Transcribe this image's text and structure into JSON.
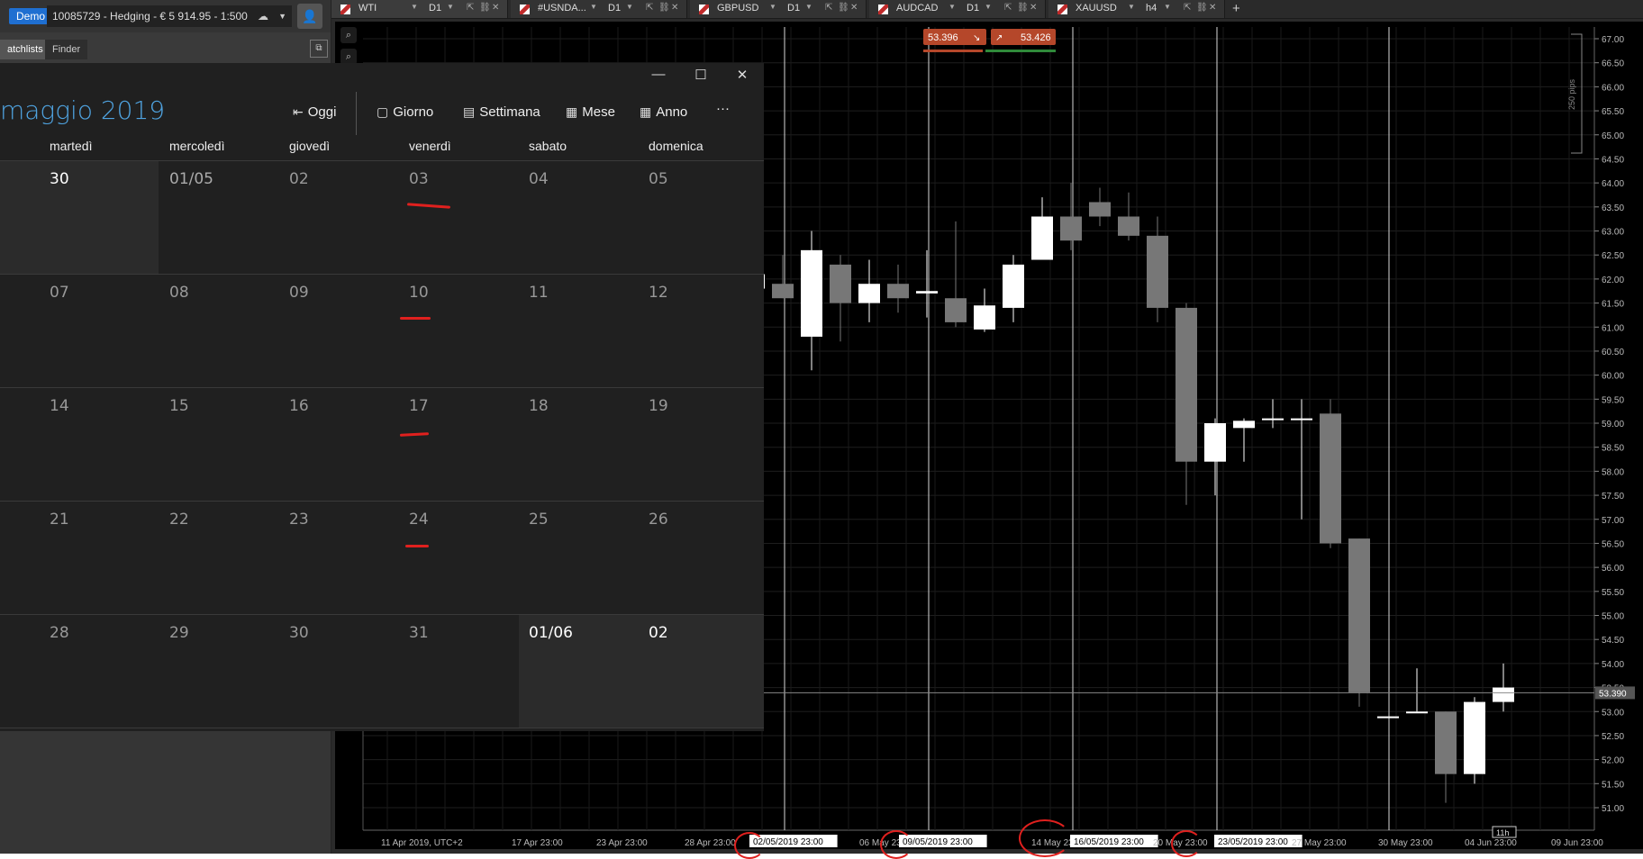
{
  "account": {
    "mode_badge": "Demo",
    "selector_label": "10085729 - Hedging - € 5 914.95 - 1:500"
  },
  "left_tabs": [
    "atchlists",
    "Finder"
  ],
  "chart_tabs": [
    {
      "symbol": "WTI",
      "timeframe": "D1"
    },
    {
      "symbol": "#USNDA...",
      "timeframe": "D1"
    },
    {
      "symbol": "GBPUSD",
      "timeframe": "D1"
    },
    {
      "symbol": "AUDCAD",
      "timeframe": "D1"
    },
    {
      "symbol": "XAUUSD",
      "timeframe": "h4"
    }
  ],
  "trade_buttons": {
    "sell": "53.39",
    "sell_suffix": "6",
    "buy": "53.42",
    "buy_suffix": "6"
  },
  "current_price_label": "53.390",
  "scale_note": "250 pips",
  "count_badge": "11h",
  "calendar": {
    "month_title": "maggio 2019",
    "buttons": {
      "today": "Oggi",
      "day": "Giorno",
      "week": "Settimana",
      "month": "Mese",
      "year": "Anno",
      "more": "···"
    },
    "weekdays": [
      "martedì",
      "mercoledì",
      "giovedì",
      "venerdì",
      "sabato",
      "domenica"
    ],
    "weeks": [
      [
        "30",
        "01/05",
        "02",
        "03",
        "04",
        "05"
      ],
      [
        "07",
        "08",
        "09",
        "10",
        "11",
        "12"
      ],
      [
        "14",
        "15",
        "16",
        "17",
        "18",
        "19"
      ],
      [
        "21",
        "22",
        "23",
        "24",
        "25",
        "26"
      ],
      [
        "28",
        "29",
        "30",
        "31",
        "01/06",
        "02"
      ]
    ]
  },
  "chart_data": {
    "type": "candlestick",
    "symbol": "WTI",
    "timeframe": "D1",
    "ylim": [
      50.6,
      67.3
    ],
    "y_ticks": [
      "67.00",
      "66.50",
      "66.00",
      "65.50",
      "65.00",
      "64.50",
      "64.00",
      "63.50",
      "63.00",
      "62.50",
      "62.00",
      "61.50",
      "61.00",
      "60.50",
      "60.00",
      "59.50",
      "59.00",
      "58.50",
      "58.00",
      "57.50",
      "57.00",
      "56.50",
      "56.00",
      "55.50",
      "55.00",
      "54.50",
      "54.00",
      "53.50",
      "53.00",
      "52.50",
      "52.00",
      "51.50",
      "51.00"
    ],
    "x_tick_labels": [
      "11 Apr 2019, UTC+2",
      "17 Apr 23:00",
      "23 Apr 23:00",
      "28 Apr 23:00",
      "02/05/2019 23:00",
      "06 May 23:00",
      "09/05/2019 23:00",
      "14 May 23:00",
      "16/05/2019 23:00",
      "20 May 23:00",
      "23/05/2019 23:00",
      "27 May 23:00",
      "30 May 23:00",
      "04 Jun 23:00",
      "09 Jun 23:00"
    ],
    "highlighted_x_labels": [
      "02/05/2019 23:00",
      "09/05/2019 23:00",
      "16/05/2019 23:00",
      "23/05/2019 23:00"
    ],
    "candles": [
      {
        "o": 61.8,
        "h": 62.4,
        "l": 61.5,
        "c": 62.1
      },
      {
        "o": 61.9,
        "h": 62.5,
        "l": 61.6,
        "c": 61.6
      },
      {
        "o": 60.8,
        "h": 63.0,
        "l": 60.1,
        "c": 62.6
      },
      {
        "o": 62.3,
        "h": 62.5,
        "l": 60.7,
        "c": 61.5
      },
      {
        "o": 61.5,
        "h": 62.4,
        "l": 61.1,
        "c": 61.9
      },
      {
        "o": 61.9,
        "h": 62.3,
        "l": 61.3,
        "c": 61.6
      },
      {
        "o": 61.7,
        "h": 62.6,
        "l": 61.2,
        "c": 61.75
      },
      {
        "o": 61.6,
        "h": 63.2,
        "l": 61.0,
        "c": 61.1
      },
      {
        "o": 60.95,
        "h": 61.8,
        "l": 60.9,
        "c": 61.45
      },
      {
        "o": 61.4,
        "h": 62.5,
        "l": 61.1,
        "c": 62.3
      },
      {
        "o": 62.4,
        "h": 63.7,
        "l": 62.4,
        "c": 63.3
      },
      {
        "o": 63.3,
        "h": 64.0,
        "l": 62.6,
        "c": 62.8
      },
      {
        "o": 63.6,
        "h": 63.9,
        "l": 63.1,
        "c": 63.3
      },
      {
        "o": 63.3,
        "h": 63.8,
        "l": 62.8,
        "c": 62.9
      },
      {
        "o": 62.9,
        "h": 63.3,
        "l": 61.1,
        "c": 61.4
      },
      {
        "o": 61.4,
        "h": 61.5,
        "l": 57.3,
        "c": 58.2
      },
      {
        "o": 58.2,
        "h": 59.1,
        "l": 57.5,
        "c": 59.0
      },
      {
        "o": 58.9,
        "h": 59.1,
        "l": 58.2,
        "c": 59.05
      },
      {
        "o": 59.1,
        "h": 59.5,
        "l": 58.9,
        "c": 59.1
      },
      {
        "o": 59.1,
        "h": 59.5,
        "l": 57.0,
        "c": 59.1
      },
      {
        "o": 59.2,
        "h": 59.5,
        "l": 56.4,
        "c": 56.5
      },
      {
        "o": 56.6,
        "h": 56.6,
        "l": 53.1,
        "c": 53.4
      },
      {
        "o": 52.9,
        "h": 52.9,
        "l": 52.9,
        "c": 52.9
      },
      {
        "o": 53.0,
        "h": 53.9,
        "l": 53.0,
        "c": 53.0
      },
      {
        "o": 53.0,
        "h": 53.0,
        "l": 51.1,
        "c": 51.7
      },
      {
        "o": 51.7,
        "h": 53.3,
        "l": 51.5,
        "c": 53.2
      },
      {
        "o": 53.2,
        "h": 54.0,
        "l": 53.0,
        "c": 53.5
      }
    ],
    "current_price": 53.39,
    "grid": true
  }
}
